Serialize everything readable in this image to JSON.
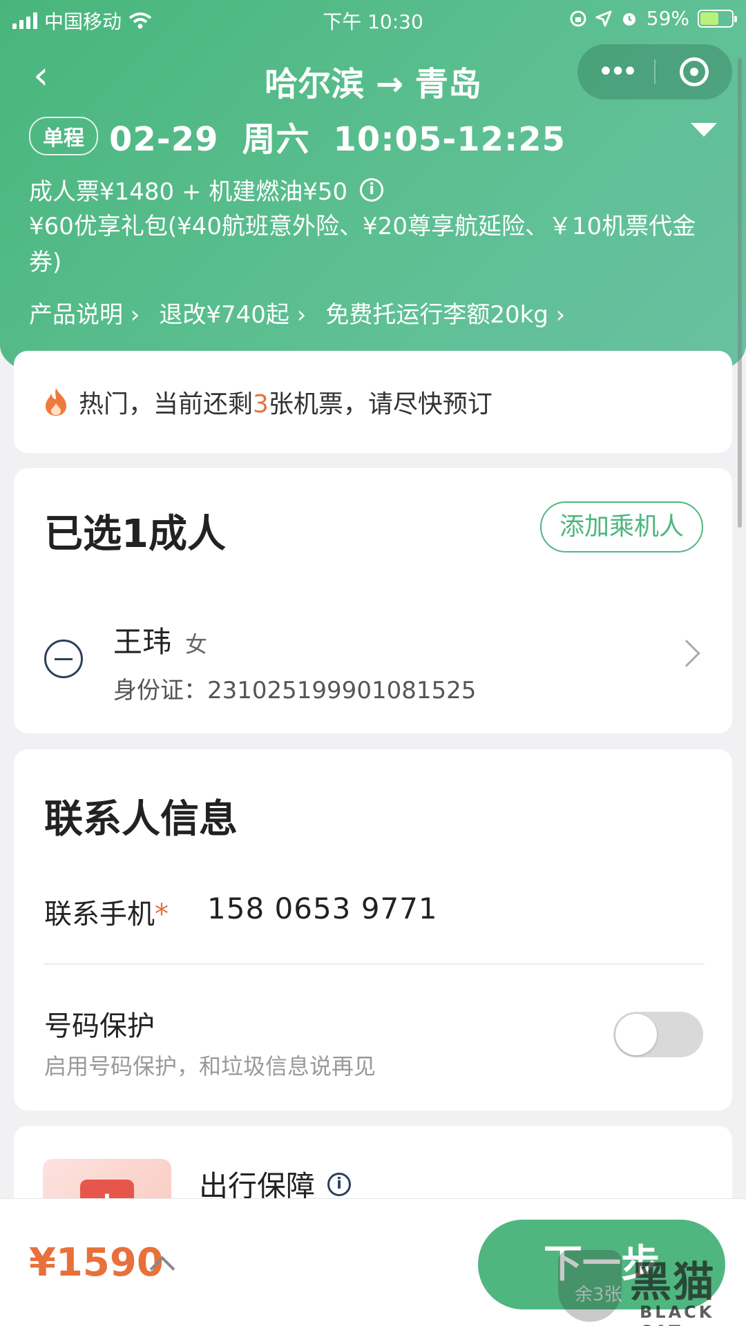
{
  "status_bar": {
    "carrier": "中国移动",
    "time": "下午 10:30",
    "battery_text": "59%",
    "battery_level": 0.59
  },
  "nav": {
    "title": "哈尔滨 → 青岛"
  },
  "trip": {
    "type_label": "单程",
    "date": "02-29",
    "weekday": "周六",
    "time_range": "10:05-12:25"
  },
  "pricing": {
    "fare_line": "成人票¥1480 + 机建燃油¥50",
    "gift_line": "¥60优享礼包(¥40航班意外险、¥20尊享航延险、￥10机票代金券)",
    "links": [
      "产品说明 ›",
      "退改¥740起 ›",
      "免费托运行李额20kg ›"
    ]
  },
  "hot_notice": {
    "prefix": "热门，当前还剩",
    "count": "3",
    "suffix": "张机票，请尽快预订"
  },
  "passengers": {
    "title": "已选1成人",
    "add_button": "添加乘机人",
    "items": [
      {
        "name": "王玮",
        "gender": "女",
        "id_line": "身份证：231025199901081525"
      }
    ]
  },
  "contact": {
    "title": "联系人信息",
    "phone_label": "联系手机",
    "required_mark": "*",
    "phone_value": "158 0653 9771",
    "protection_label": "号码保护",
    "protection_desc": "启用号码保护，和垃圾信息说再见",
    "protection_enabled": false
  },
  "insurance": {
    "title": "出行保障"
  },
  "footer": {
    "total_price": "¥1590",
    "next_button": "下一步",
    "remaining": "余3张"
  },
  "watermark": {
    "cn": "黑猫",
    "en": "BLACK CAT"
  },
  "colors": {
    "header_green": "#4fb67e",
    "accent_orange": "#e8703a",
    "button_green": "#50b67f"
  },
  "icons": [
    "back-icon",
    "more-icon",
    "target-icon",
    "dropdown-icon",
    "info-icon",
    "flame-icon",
    "remove-icon",
    "chevron-right-icon",
    "caret-up-icon",
    "shield-icon"
  ]
}
